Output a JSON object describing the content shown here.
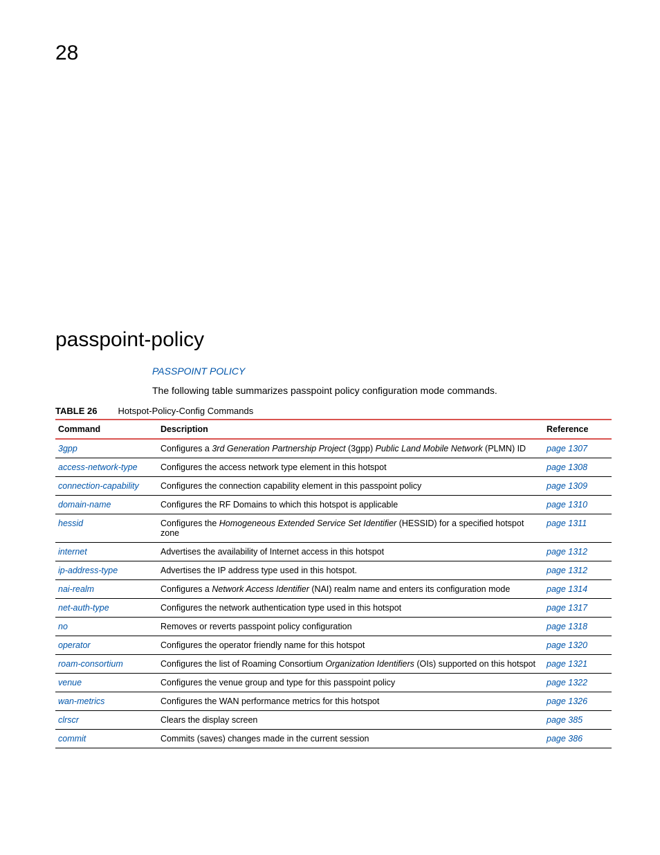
{
  "page_number": "28",
  "title": "passpoint-policy",
  "subtitle": "PASSPOINT POLICY",
  "intro": "The following table summarizes passpoint policy configuration mode commands.",
  "table_label": "TABLE 26",
  "table_title": "Hotspot-Policy-Config Commands",
  "headers": {
    "command": "Command",
    "description": "Description",
    "reference": "Reference"
  },
  "rows": [
    {
      "cmd": "3gpp",
      "desc_pre": "Configures a ",
      "desc_em1": "3rd Generation Partnership Project",
      "desc_mid": " (3gpp) ",
      "desc_em2": "Public Land Mobile Network",
      "desc_post": " (PLMN) ID",
      "ref": "page 1307"
    },
    {
      "cmd": "access-network-type",
      "desc_pre": "Configures the access network type element in this hotspot",
      "ref": "page 1308"
    },
    {
      "cmd": "connection-capability",
      "desc_pre": "Configures the connection capability element in this passpoint policy",
      "ref": "page 1309"
    },
    {
      "cmd": "domain-name",
      "desc_pre": "Configures the RF Domains to which this hotspot is applicable",
      "ref": "page 1310"
    },
    {
      "cmd": "hessid",
      "desc_pre": "Configures the ",
      "desc_em1": "Homogeneous Extended Service Set Identifier",
      "desc_mid": " (HESSID) for a specified hotspot zone",
      "ref": "page 1311"
    },
    {
      "cmd": "internet",
      "desc_pre": "Advertises the availability of Internet access in this hotspot",
      "ref": "page 1312"
    },
    {
      "cmd": "ip-address-type",
      "desc_pre": "Advertises the IP address type used in this hotspot.",
      "ref": "page 1312"
    },
    {
      "cmd": "nai-realm",
      "desc_pre": "Configures a ",
      "desc_em1": "Network Access Identifier",
      "desc_mid": " (NAI) realm name and enters its configuration mode",
      "ref": "page 1314"
    },
    {
      "cmd": "net-auth-type",
      "desc_pre": "Configures the network authentication type used in this hotspot",
      "ref": "page 1317"
    },
    {
      "cmd": "no",
      "desc_pre": "Removes or reverts passpoint policy configuration",
      "ref": "page 1318"
    },
    {
      "cmd": "operator",
      "desc_pre": "Configures the operator friendly name for this hotspot",
      "ref": "page 1320"
    },
    {
      "cmd": "roam-consortium",
      "desc_pre": "Configures the list of Roaming Consortium ",
      "desc_em1": "Organization Identifiers",
      "desc_mid": " (OIs) supported on this hotspot",
      "ref": "page 1321"
    },
    {
      "cmd": "venue",
      "desc_pre": "Configures the venue group and type for this passpoint policy",
      "ref": "page 1322"
    },
    {
      "cmd": "wan-metrics",
      "desc_pre": "Configures the WAN performance metrics for this hotspot",
      "ref": "page 1326"
    },
    {
      "cmd": "clrscr",
      "desc_pre": "Clears the display screen",
      "ref": "page 385"
    },
    {
      "cmd": "commit",
      "desc_pre": "Commits (saves) changes made in the current session",
      "ref": "page 386"
    }
  ]
}
